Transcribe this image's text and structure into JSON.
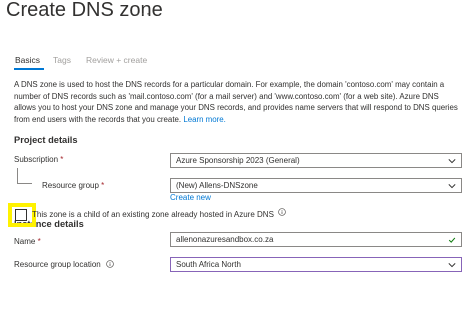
{
  "page": {
    "title": "Create DNS zone",
    "more": "···"
  },
  "tabs": [
    {
      "label": "Basics",
      "active": true
    },
    {
      "label": "Tags",
      "active": false
    },
    {
      "label": "Review + create",
      "active": false
    }
  ],
  "description": {
    "text": "A DNS zone is used to host the DNS records for a particular domain. For example, the domain 'contoso.com' may contain a number of DNS records such as 'mail.contoso.com' (for a mail server) and 'www.contoso.com' (for a web site). Azure DNS allows you to host your DNS zone and manage your DNS records, and provides name servers that will respond to DNS queries from end users with the records that you create.",
    "link": "Learn more."
  },
  "project": {
    "heading": "Project details",
    "subscription_label": "Subscription",
    "subscription_value": "Azure Sponsorship 2023 (General)",
    "resource_group_label": "Resource group",
    "resource_group_value": "(New) Allens-DNSzone",
    "create_new": "Create new"
  },
  "instance": {
    "heading": "Instance details",
    "child_zone_label": "This zone is a child of an existing zone already hosted in Azure DNS",
    "child_zone_checked": false,
    "name_label": "Name",
    "name_value": "allenonazuresandbox.co.za",
    "location_label": "Resource group location",
    "location_value": "South Africa North"
  },
  "required_marker": "*",
  "colors": {
    "accent": "#0078d4",
    "highlight": "#fff200",
    "valid": "#107c10",
    "focus": "#8764b8",
    "required": "#a4262c"
  }
}
